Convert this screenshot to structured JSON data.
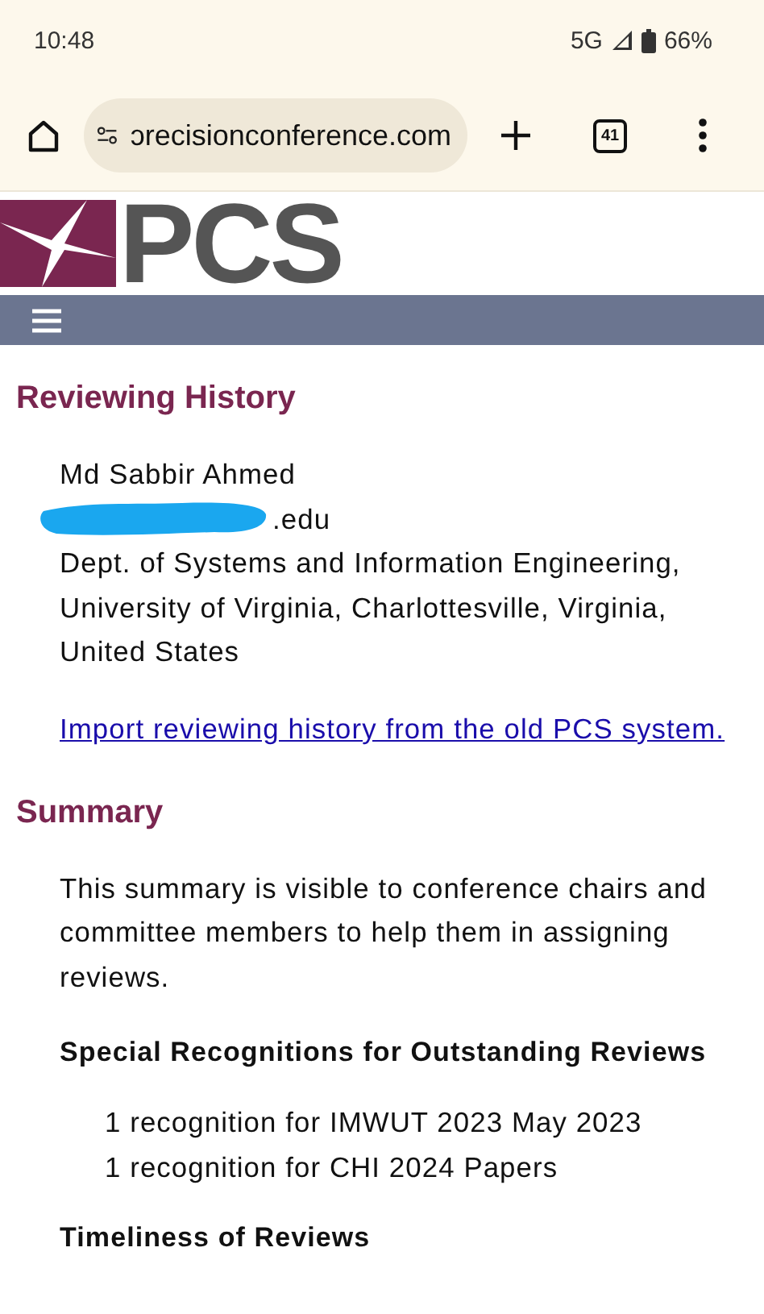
{
  "status_bar": {
    "time": "10:48",
    "network": "5G",
    "battery": "66%"
  },
  "browser": {
    "url": "ɔrecisionconference.com",
    "tab_count": "41"
  },
  "logo": {
    "text": "PCS"
  },
  "page": {
    "title": "Reviewing History",
    "profile": {
      "name": "Md Sabbir Ahmed",
      "email_visible": ".edu",
      "affiliation": "Dept. of Systems and Information Engineering, University of Virginia, Charlottesville, Virginia, United States"
    },
    "import_link": "Import reviewing history from the old PCS system.",
    "summary": {
      "title": "Summary",
      "description": "This summary is visible to conference chairs and committee members to help them in assigning reviews.",
      "sections": [
        {
          "title": "Special Recognitions for Outstanding Reviews",
          "items": [
            "1 recognition for IMWUT 2023 May 2023",
            "1 recognition for CHI 2024 Papers"
          ]
        },
        {
          "title": "Timeliness of Reviews"
        }
      ]
    }
  }
}
